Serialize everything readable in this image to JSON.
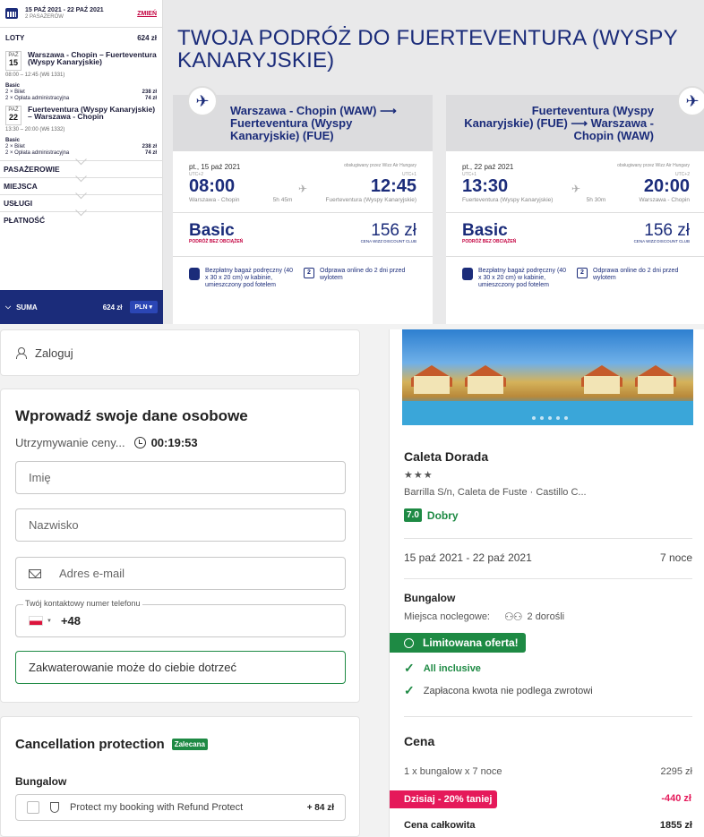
{
  "sidebar": {
    "dates": "15 PAŹ 2021 - 22 PAŹ 2021",
    "passengers": "2 PASAŻERÓW",
    "change": "ZMIEŃ",
    "flights_label": "LOTY",
    "flights_total": "624 zł",
    "outbound": {
      "month": "PAŹ",
      "day": "15",
      "route": "Warszawa - Chopin – Fuerteventura (Wyspy Kanaryjskie)",
      "time": "08:00 – 12:45 (W6 1331)",
      "fare": "Basic",
      "ticket": "2 × Bilet",
      "ticket_price": "238 zł",
      "fee": "2 × Opłata administracyjna",
      "fee_price": "74 zł"
    },
    "inbound": {
      "month": "PAŹ",
      "day": "22",
      "route": "Fuerteventura (Wyspy Kanaryjskie) – Warszawa - Chopin",
      "time": "13:30 – 20:00 (W6 1332)",
      "fare": "Basic",
      "ticket": "2 × Bilet",
      "ticket_price": "238 zł",
      "fee": "2 × Opłata administracyjna",
      "fee_price": "74 zł"
    },
    "sections": [
      "PASAŻEROWIE",
      "MIEJSCA",
      "USŁUGI",
      "PŁATNOŚĆ"
    ],
    "sum_label": "SUMA",
    "sum_value": "624 zł",
    "currency": "PLN"
  },
  "trip_title": "TWOJA PODRÓŻ DO FUERTEVENTURA (WYSPY KANARYJSKIE)",
  "flights": [
    {
      "heading": "Warszawa - Chopin (WAW) ⟶ Fuerteventura (Wyspy Kanaryjskie) (FUE)",
      "date": "pt., 15 paź 2021",
      "operator": "obsługiwany przez Wizz Air Hungary",
      "dep_utc": "UTC+2",
      "arr_utc": "UTC+1",
      "dep": "08:00",
      "arr": "12:45",
      "dep_place": "Warszawa - Chopin",
      "duration": "5h 45m",
      "arr_place": "Fuerteventura (Wyspy Kanaryjskie)",
      "fare": "Basic",
      "fare_sub": "PODRÓŻ BEZ OBCIĄŻEŃ",
      "price": "156 zł",
      "price_sub": "CENA WIZZ DISCOUNT CLUB",
      "bag": "Bezpłatny bagaż podręczny (40 x 30 x 20 cm) w kabinie, umieszczony pod fotelem",
      "checkin": "Odprawa online do 2 dni przed wylotem"
    },
    {
      "heading": "Fuerteventura (Wyspy Kanaryjskie) (FUE) ⟶ Warszawa - Chopin (WAW)",
      "date": "pt., 22 paź 2021",
      "operator": "obsługiwany przez Wizz Air Hungary",
      "dep_utc": "UTC+1",
      "arr_utc": "UTC+2",
      "dep": "13:30",
      "arr": "20:00",
      "dep_place": "Fuerteventura (Wyspy Kanaryjskie)",
      "duration": "5h 30m",
      "arr_place": "Warszawa - Chopin",
      "fare": "Basic",
      "fare_sub": "PODRÓŻ BEZ OBCIĄŻEŃ",
      "price": "156 zł",
      "price_sub": "CENA WIZZ DISCOUNT CLUB",
      "bag": "Bezpłatny bagaż podręczny (40 x 30 x 20 cm) w kabinie, umieszczony pod fotelem",
      "checkin": "Odprawa online do 2 dni przed wylotem"
    }
  ],
  "login": "Zaloguj",
  "form": {
    "title": "Wprowadź swoje dane osobowe",
    "hold_text": "Utrzymywanie ceny...",
    "timer": "00:19:53",
    "first_name_placeholder": "Imię",
    "last_name_placeholder": "Nazwisko",
    "email_placeholder": "Adres e-mail",
    "phone_label": "Twój kontaktowy numer telefonu",
    "phone_prefix": "+48",
    "accommodation_note": "Zakwaterowanie może do ciebie dotrzeć"
  },
  "cancellation": {
    "title": "Cancellation protection",
    "badge": "Zalecana",
    "room": "Bungalow",
    "option": "Protect my booking with Refund Protect",
    "option_price": "+ 84 zł"
  },
  "hotel": {
    "name": "Caleta Dorada",
    "stars": "★★★",
    "address": "Barrilla S/n, Caleta de Fuste · Castillo C...",
    "rating": "7.0",
    "rating_text": "Dobry",
    "dates": "15 paź 2021 - 22 paź 2021",
    "nights": "7 noce",
    "room": "Bungalow",
    "occupancy_label": "Miejsca noclegowe:",
    "occupancy": "2 dorośli",
    "limited": "Limitowana oferta!",
    "all_inclusive": "All inclusive",
    "nonrefundable": "Zapłacona kwota nie podlega zwrotowi",
    "price_title": "Cena",
    "line_label": "1 x bungalow x 7 noce",
    "line_price": "2295 zł",
    "discount_label": "Dzisiaj - 20% taniej",
    "discount_value": "-440 zł",
    "total_label": "Cena całkowita",
    "total_value": "1855 zł"
  }
}
